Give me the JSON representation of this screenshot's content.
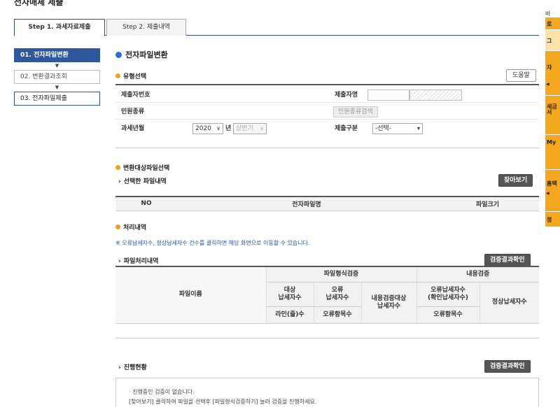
{
  "page": {
    "title": "전자매체 제출"
  },
  "tabs": [
    {
      "label": "Step 1. 과세자료제출",
      "active": true
    },
    {
      "label": "Step 2. 제출내역",
      "active": false
    }
  ],
  "steps": [
    {
      "label": "01. 전자파일변환",
      "state": "active"
    },
    {
      "label": "02. 변환결과조회",
      "state": "normal"
    },
    {
      "label": "03. 전자파일제출",
      "state": "outlined"
    }
  ],
  "main": {
    "title": "전자파일변환",
    "type_section": {
      "title": "유형선택",
      "help_button": "도움말",
      "submitter_no_label": "제출자번호",
      "submitter_name_label": "제출자명",
      "complaint_type_label": "민원종류",
      "complaint_search_button": "민원종류검색",
      "tax_year_label": "과세년월",
      "year_value": "2020",
      "year_suffix": "년",
      "half_value": "상반기",
      "submit_type_label": "제출구분",
      "submit_type_value": "-선택-"
    },
    "file_section": {
      "title": "변환대상파일선택",
      "selected_files_title": "선택한 파일내역",
      "browse_button": "찾아보기",
      "columns": [
        "NO",
        "전자파일명",
        "파일크기"
      ]
    },
    "process_section": {
      "title": "처리내역",
      "notice": "※ 오류납세자수, 정상납세자수 건수를 클릭하면 해당 화면으로 이동할 수 있습니다.",
      "file_process_title": "파일처리내역",
      "verify_button": "검증결과확인",
      "headers": {
        "file_name": "파일이름",
        "format_check": "파일형식검증",
        "content_check": "내용검증",
        "target_taxpayers": "대상\n납세자수",
        "error_taxpayers": "오류\n납세자수",
        "content_target": "내용검증대상\n납세자수",
        "error_taxpayers_confirmed": "오류납세자수\n(확인납세자수)",
        "normal_taxpayers": "정상납세자수",
        "lines": "라인(줄)수",
        "error_items": "오류항목수",
        "error_items2": "오류항목수"
      }
    },
    "progress_section": {
      "title": "진행현황",
      "verify_button": "검증결과확인",
      "line1": "· 진행중인 검증이 없습니다.",
      "line2": "[찾아보기] 클릭하여 파일을 선택후 [파일형식검증하기] 눌러 검증을 진행하세요."
    }
  },
  "right_panel": {
    "top": "바",
    "items": [
      "로",
      "그",
      "자",
      "세금\n서",
      "My",
      "홈택",
      "정"
    ]
  },
  "colors": {
    "primary": "#2f579b",
    "accent_orange": "#f0a020",
    "button_dark": "#555555",
    "side_orange": "#f3a81f"
  }
}
